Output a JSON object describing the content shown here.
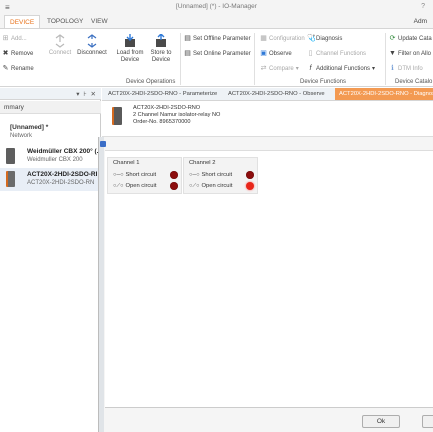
{
  "window": {
    "app_icon": "≡",
    "title": "[Unnamed] (*) - IO-Manager",
    "help": "?"
  },
  "menu": {
    "tabs": [
      "DEVICE",
      "TOPOLOGY",
      "VIEW"
    ],
    "active_tab": "DEVICE",
    "user": "Adm"
  },
  "ribbon": {
    "add": "Add...",
    "remove": "Remove",
    "rename": "Rename",
    "connect": "Connect",
    "disconnect": "Disconnect",
    "load_from_device": "Load from Device",
    "store_to_device": "Store to Device",
    "load_line1": "Load from",
    "load_line2": "Device",
    "store_line1": "Store to",
    "store_line2": "Device",
    "device_operations_label": "Device Operations",
    "set_offline": "Set Offline Parameter",
    "set_online": "Set Online Parameter",
    "configuration": "Configuration",
    "observe": "Observe",
    "compare": "Compare",
    "diagnosis": "Diagnosis",
    "channel_functions": "Channel Functions",
    "additional_functions": "Additional Functions",
    "device_functions_label": "Device Functions",
    "update_catalog": "Update Cata",
    "filter_on": "Filter on Allo",
    "dtm_info": "DTM Info",
    "device_catalog_label": "Device Catalo"
  },
  "sidebar": {
    "summary": "mmary",
    "project": "[Unnamed] *",
    "network": "Network",
    "devices": [
      {
        "name": "Weidmüller CBX 200° (...",
        "sub": "Weidmuller CBX 200"
      },
      {
        "name": "ACT20X-2HDI-2SDO-RI",
        "sub": "ACT20X-2HDI-2SDO-RN"
      }
    ]
  },
  "doc_tabs": [
    "ACT20X-2HDI-2SDO-RNO - Parameterize",
    "ACT20X-2HDI-2SDO-RNO - Observe",
    "ACT20X-2HDI-2SDO-RNO - Diagnosis"
  ],
  "device_header": {
    "line1": "ACT20X-2HDI-2SDO-RNO",
    "line2": "2 Channel Namur isolator-relay NO",
    "line3": "Order-No. 8965370000"
  },
  "channels": [
    {
      "title": "Channel 1",
      "short": "Short circuit",
      "open": "Open circuit",
      "short_state": "off",
      "open_state": "off"
    },
    {
      "title": "Channel 2",
      "short": "Short circuit",
      "open": "Open circuit",
      "short_state": "off",
      "open_state": "on"
    }
  ],
  "colors": {
    "accent": "#e8731c",
    "active_doc_tab": "#f39a52",
    "led_off": "#8c0d0d",
    "led_on": "#e8261a"
  },
  "footer": {
    "ok": "Ok"
  }
}
